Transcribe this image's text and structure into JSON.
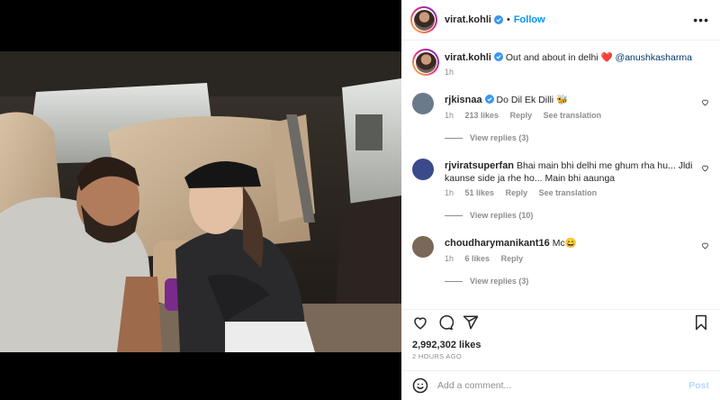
{
  "post": {
    "username": "virat.kohli",
    "follow_label": "Follow",
    "more_label": "•••",
    "caption": {
      "username": "virat.kohli",
      "text": "Out and about in delhi",
      "emoji": "❤️",
      "mention": "@anushkasharma",
      "age": "1h"
    }
  },
  "comments": [
    {
      "username": "rjkisnaa",
      "verified": true,
      "text": "Do Dil Ek Dilli 🐝",
      "age": "1h",
      "likes": "213 likes",
      "reply": "Reply",
      "translate": "See translation",
      "view_replies": "View replies (3)",
      "avatar_color": "#6b7a8a"
    },
    {
      "username": "rjviratsuperfan",
      "verified": false,
      "text": "Bhai main bhi delhi me ghum rha hu... Jldi kaunse side ja rhe ho... Main bhi aaunga",
      "age": "1h",
      "likes": "51 likes",
      "reply": "Reply",
      "translate": "See translation",
      "view_replies": "View replies (10)",
      "avatar_color": "#3a4a8a"
    },
    {
      "username": "choudharymanikant16",
      "verified": false,
      "text": "Mc😄",
      "age": "1h",
      "likes": "6 likes",
      "reply": "Reply",
      "translate": "",
      "view_replies": "View replies (3)",
      "avatar_color": "#7a6858"
    }
  ],
  "icons": {
    "like": "heart-icon",
    "comment": "comment-icon",
    "share": "share-icon",
    "save": "bookmark-icon",
    "emoji": "smiley-icon"
  },
  "likes_count": "2,992,302 likes",
  "timestamp": "2 HOURS AGO",
  "add_comment": {
    "placeholder": "Add a comment...",
    "post_label": "Post"
  },
  "colors": {
    "accent": "#0095f6",
    "verified": "#3897f0",
    "heart": "#ed4956"
  }
}
